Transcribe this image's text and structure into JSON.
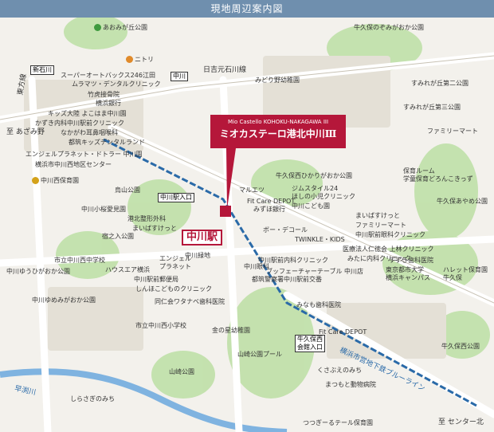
{
  "header": {
    "title": "現地周辺案内図"
  },
  "property": {
    "name_en": "Mio Castello KOHOKU-NAKAGAWA III",
    "name_jp": "ミオカステーロ港北中川Ⅲ"
  },
  "station": {
    "name": "中川駅"
  },
  "roads": {
    "hiyoshi": "日吉元石川線",
    "azamino": "至 あざみ野",
    "center_kita": "至 センター北",
    "higashikata": "東方線",
    "blueline": "横浜市営地下鉄ブルーライン",
    "hayabuchi": "早渕川",
    "shirasagi": "しらさぎのみち",
    "kusabue": "くさぶえのみち"
  },
  "signals": {
    "shin_ishikawa": "新石川",
    "nakagawa": "中川",
    "nakagawa_ekiiriguchi": "中川駅入口",
    "ushikubo": "牛久保西\n会館入口"
  },
  "labels": {
    "aominegaoka": "あおみが丘公園",
    "ushikubo_nozomi": "牛久保のぞみがおか公園",
    "nitori": "ニトリ",
    "super_autobacs": "スーパーオートバックス246江田",
    "muramatsu": "ムラマツ・デンタルクリニック",
    "midorino": "みどり野幼稚園",
    "takeko": "竹虎接骨院",
    "yokohama_bank": "横浜銀行",
    "sumire2": "すみれが丘第二公園",
    "sumire3": "すみれが丘第三公園",
    "kids_osaka": "キッズ大陸 よこはま中川園",
    "kakiuchi": "かずき内科中川駅前クリニック",
    "nakagawa_ent": "なかがわ耳鼻咽喉科",
    "tsuzuki_kids": "都筑キッズデンタルランド",
    "familymart": "ファミリーマート",
    "energy_planet": "エンジェルプラネット・ドトラー 中川園",
    "yokohama_west": "横浜市中川西地区センター",
    "maruetsu": "マルエツ",
    "nakagawa_nishi": "中川西保育園",
    "karasuyama": "烏山公園",
    "fitcare": "Fit Care DEPOT",
    "mizuho": "みずほ銀行",
    "ushikubo_hikari": "牛久保西ひかりがおか公園",
    "gym": "ジムスタイル24",
    "hoshino": "ほしの小児クリニック",
    "nakagawa_kodomo": "中川こども園",
    "hoiku_room": "保育ルーム\n学童保育どろんこきっず",
    "ushikubo_ayame": "牛久保あやめ公園",
    "kosakurai": "中川小桜愛見園",
    "kohoku_seikei": "港北整形外科",
    "mainosuke": "まいばすけっと",
    "mainosuke2": "まいばすけっと",
    "familymart2": "ファミリーマート",
    "nakagawa_ekimae": "中川駅前眼科クリニック",
    "toriuchi": "宿之入公園",
    "bo_decor": "ボー・デコール",
    "twinkle": "TWINKLE・KIDS",
    "iryo": "医療法人仁徳会 上林クリニック",
    "mitani": "みたに内科クリニック",
    "suzuki": "すずき歯科医院",
    "tokyo_univ": "東京都市大学\n横浜キャンパス",
    "haretto": "ハレット保育園\n牛久保",
    "ichiritsu_chu": "市立中川西中学校",
    "nakagawa_yuki": "中川ゆうひがおか公園",
    "house_esu": "ハウスエア横浜",
    "angel": "エンジェル\nプラネット",
    "nakagawa_ryokuchi": "中川緑地",
    "nakagawa_ekimae_naika": "中川駅前内科クリニック",
    "buffet": "ブッフェーチャーテーブル 中川店",
    "nakagawa_ganka": "中川眼科",
    "nakagawa_post": "中川駅前郵便局",
    "shinjo": "しんほこどものクリニック",
    "tsuzuki_police": "都筑警察署中川駅前交番",
    "nakagawa_yumemi": "中川ゆめみがおか公園",
    "doujinkai": "同仁会ワタナベ歯科医院",
    "minamo": "みなも歯科医院",
    "ichiritsu_sho": "市立中川西小学校",
    "kin_hoshi": "金の星幼稚園",
    "fitcare2": "Fit Care DEPOT",
    "yamasaki_pool": "山崎公園プール",
    "yamasaki": "山崎公園",
    "ushikubo_nishi_park": "牛久保西公園",
    "matsumoto": "まつもと動物病院",
    "tsutsuji": "つつぎーるテール保育園"
  }
}
